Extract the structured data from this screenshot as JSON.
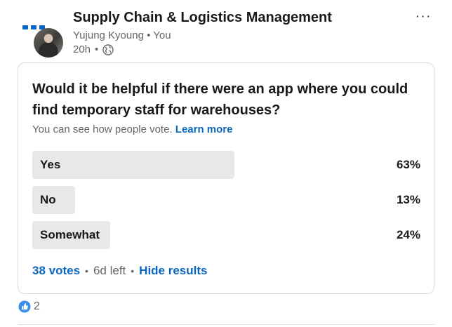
{
  "post": {
    "group_name": "Supply Chain & Logistics Management",
    "author": "Yujung Kyoung",
    "author_suffix": "You",
    "time_ago": "20h",
    "visibility_icon": "globe-icon",
    "more_icon": "more-horizontal-icon",
    "more_label": "···"
  },
  "poll": {
    "question": "Would it be helpful if there were an app where you could find temporary staff for warehouses?",
    "vote_note": "You can see how people vote.",
    "learn_more": "Learn more",
    "options": [
      {
        "label": "Yes",
        "percent_label": "63%",
        "fill_fraction": 0.52
      },
      {
        "label": "No",
        "percent_label": "13%",
        "fill_fraction": 0.11
      },
      {
        "label": "Somewhat",
        "percent_label": "24%",
        "fill_fraction": 0.2
      }
    ],
    "votes": "38 votes",
    "time_left": "6d left",
    "hide_results": "Hide results"
  },
  "reactions": {
    "icon": "like-icon",
    "count": "2"
  },
  "colors": {
    "accent": "#0a66c2",
    "bar": "#e8e8e8",
    "muted_text": "#666666"
  }
}
